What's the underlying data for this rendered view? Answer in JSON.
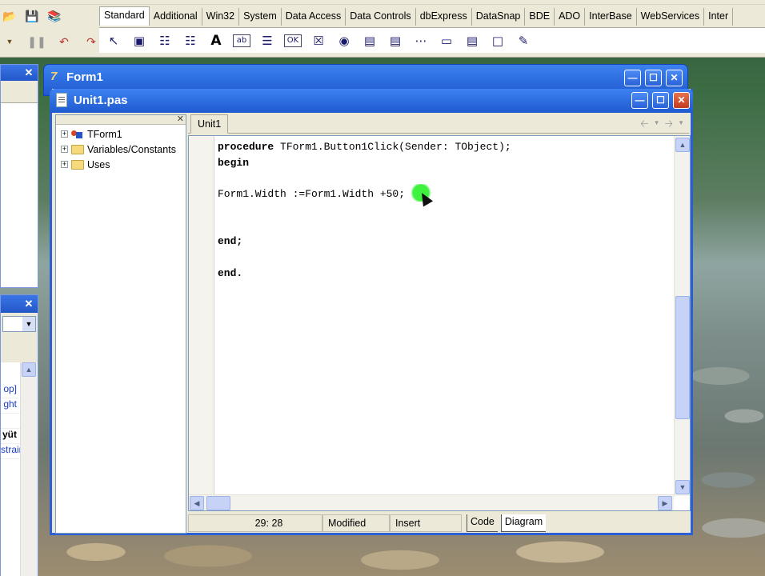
{
  "ide": {
    "palette_tabs": [
      "Standard",
      "Additional",
      "Win32",
      "System",
      "Data Access",
      "Data Controls",
      "dbExpress",
      "DataSnap",
      "BDE",
      "ADO",
      "InterBase",
      "WebServices",
      "Inter"
    ],
    "palette_icons": [
      "pointer-icon",
      "frame-icon",
      "mainmenu-icon",
      "popupmenu-icon",
      "label-icon",
      "edit-icon",
      "memo-icon",
      "button-icon",
      "checkbox-icon",
      "radiobutton-icon",
      "listbox-icon",
      "combobox-icon",
      "scrollbar-icon",
      "groupbox-icon",
      "radiogroup-icon",
      "panel-icon",
      "actionlist-icon"
    ]
  },
  "object_inspector": {
    "visible_rows": [
      "op]",
      "ght",
      "",
      "yüt",
      "strair"
    ]
  },
  "form1": {
    "title": "Form1"
  },
  "editor": {
    "title": "Unit1.pas",
    "tab": "Unit1",
    "tree": [
      {
        "label": "TForm1",
        "icon": "form-icon"
      },
      {
        "label": "Variables/Constants",
        "icon": "folder-icon"
      },
      {
        "label": "Uses",
        "icon": "folder-icon"
      }
    ],
    "code_lines": [
      {
        "text": "procedure TForm1.Button1Click(Sender: TObject);",
        "bold": "procedure"
      },
      {
        "text": "begin",
        "bold": "begin"
      },
      {
        "text": "",
        "bold": ""
      },
      {
        "text": "Form1.Width :=Form1.Width +50;",
        "bold": ""
      },
      {
        "text": "",
        "bold": ""
      },
      {
        "text": "",
        "bold": ""
      },
      {
        "text": "end;",
        "bold": "end;"
      },
      {
        "text": "",
        "bold": ""
      },
      {
        "text": "end.",
        "bold": "end."
      }
    ],
    "status": {
      "position": "29: 28",
      "modified": "Modified",
      "mode": "Insert",
      "view_tabs": [
        "Code",
        "Diagram"
      ]
    }
  }
}
